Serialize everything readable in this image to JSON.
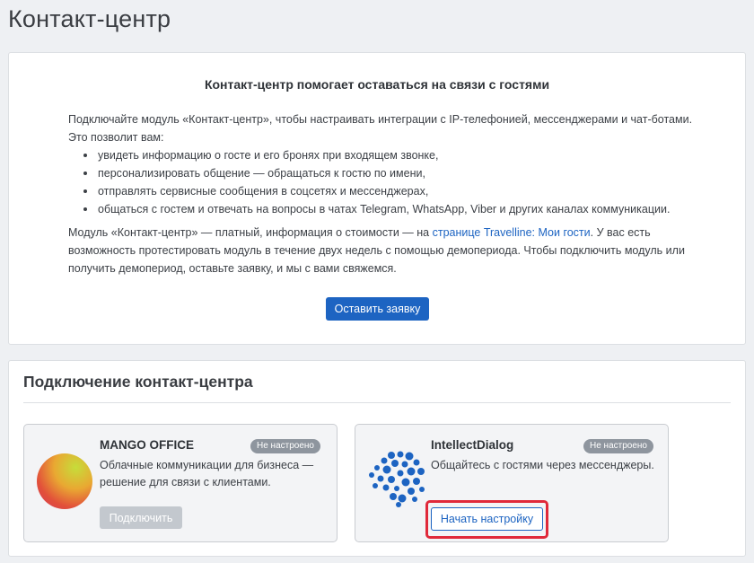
{
  "page": {
    "title": "Контакт-центр"
  },
  "info": {
    "heading": "Контакт-центр помогает оставаться на связи с гостями",
    "intro": "Подключайте модуль «Контакт-центр», чтобы настраивать интеграции с IP-телефонией, мессенджерами и чат-ботами. Это позволит вам:",
    "bullets": [
      "увидеть информацию о госте и его бронях при входящем звонке,",
      "персонализировать общение — обращаться к гостю по имени,",
      "отправлять сервисные сообщения в соцсетях и мессенджерах,",
      "общаться с гостем и отвечать на вопросы в чатах Telegram, WhatsApp, Viber и других каналах коммуникации."
    ],
    "outro_before": "Модуль «Контакт-центр» — платный, информация о стоимости — на ",
    "outro_link": "странице Travelline: Мои гости",
    "outro_after": ". У вас есть возможность протестировать модуль в течение двух недель с помощью демопериода. Чтобы подключить модуль или получить демопериод, оставьте заявку, и мы с вами свяжемся.",
    "button_label": "Оставить заявку"
  },
  "connection": {
    "title": "Подключение контакт-центра",
    "providers": [
      {
        "name": "MANGO OFFICE",
        "status": "Не настроено",
        "description": "Облачные коммуникации для бизнеса — решение для связи с клиентами.",
        "button_label": "Подключить",
        "icon": "mango-logo-icon"
      },
      {
        "name": "IntellectDialog",
        "status": "Не настроено",
        "description": "Общайтесь с гостями через мессенджеры.",
        "button_label": "Начать настройку",
        "icon": "brain-icon"
      }
    ]
  },
  "colors": {
    "accent": "#1d64c2",
    "highlight": "#e0293a",
    "badge": "#8e959e",
    "disabled_button": "#c3c8ce"
  }
}
